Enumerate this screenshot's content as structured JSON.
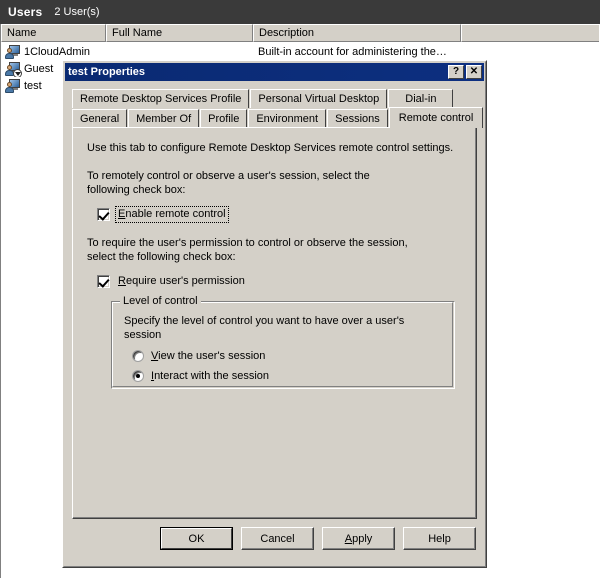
{
  "mmc": {
    "header": {
      "title": "Users",
      "count": "2 User(s)"
    },
    "columns": [
      {
        "label": "Name"
      },
      {
        "label": "Full Name"
      },
      {
        "label": "Description"
      },
      {
        "label": ""
      }
    ],
    "rows": [
      {
        "icon": "user-icon",
        "name": "1CloudAdmin",
        "full_name": "",
        "description": "Built-in account for administering the…"
      },
      {
        "icon": "user-disabled-icon",
        "name": "Guest",
        "full_name": "",
        "description": ""
      },
      {
        "icon": "user-icon",
        "name": "test",
        "full_name": "",
        "description": ""
      }
    ]
  },
  "dialog": {
    "title": "test Properties",
    "titlebar_buttons": [
      {
        "name": "help-button",
        "glyph": "?"
      },
      {
        "name": "close-button",
        "glyph": "✕"
      }
    ],
    "tabs_row1": [
      {
        "label": "Remote Desktop Services Profile",
        "selected": false
      },
      {
        "label": "Personal Virtual Desktop",
        "selected": false
      },
      {
        "label": "Dial-in",
        "selected": false
      }
    ],
    "tabs_row2": [
      {
        "label": "General",
        "selected": false
      },
      {
        "label": "Member Of",
        "selected": false
      },
      {
        "label": "Profile",
        "selected": false
      },
      {
        "label": "Environment",
        "selected": false
      },
      {
        "label": "Sessions",
        "selected": false
      },
      {
        "label": "Remote control",
        "selected": true
      }
    ],
    "content": {
      "intro": "Use this tab to configure Remote Desktop Services remote control settings.",
      "instruction_1": "To remotely control or observe a user's session, select the following check box:",
      "enable_remote_control": {
        "label": "Enable remote control",
        "accelerator": "E",
        "checked": true,
        "focused": true
      },
      "instruction_2": "To require the user's permission to control or observe the session, select the following check box:",
      "require_permission": {
        "label": "Require user's permission",
        "accelerator": "R",
        "checked": true
      },
      "level_of_control": {
        "title": "Level of control",
        "description": "Specify the level of control you want to have over a user's session",
        "options": [
          {
            "label": "View the user's session",
            "accelerator": "V",
            "selected": false
          },
          {
            "label": "Interact with the session",
            "accelerator": "I",
            "selected": true
          }
        ]
      }
    },
    "buttons": [
      {
        "name": "ok-button",
        "label": "OK",
        "default": true
      },
      {
        "name": "cancel-button",
        "label": "Cancel",
        "default": false
      },
      {
        "name": "apply-button",
        "label": "Apply",
        "default": false
      },
      {
        "name": "help-button",
        "label": "Help",
        "default": false
      }
    ]
  },
  "colors": {
    "dialog_face": "#d4d0c8",
    "titlebar": "#0a246a",
    "header_band": "#3a3a3a",
    "list_background": "#ffffff"
  }
}
